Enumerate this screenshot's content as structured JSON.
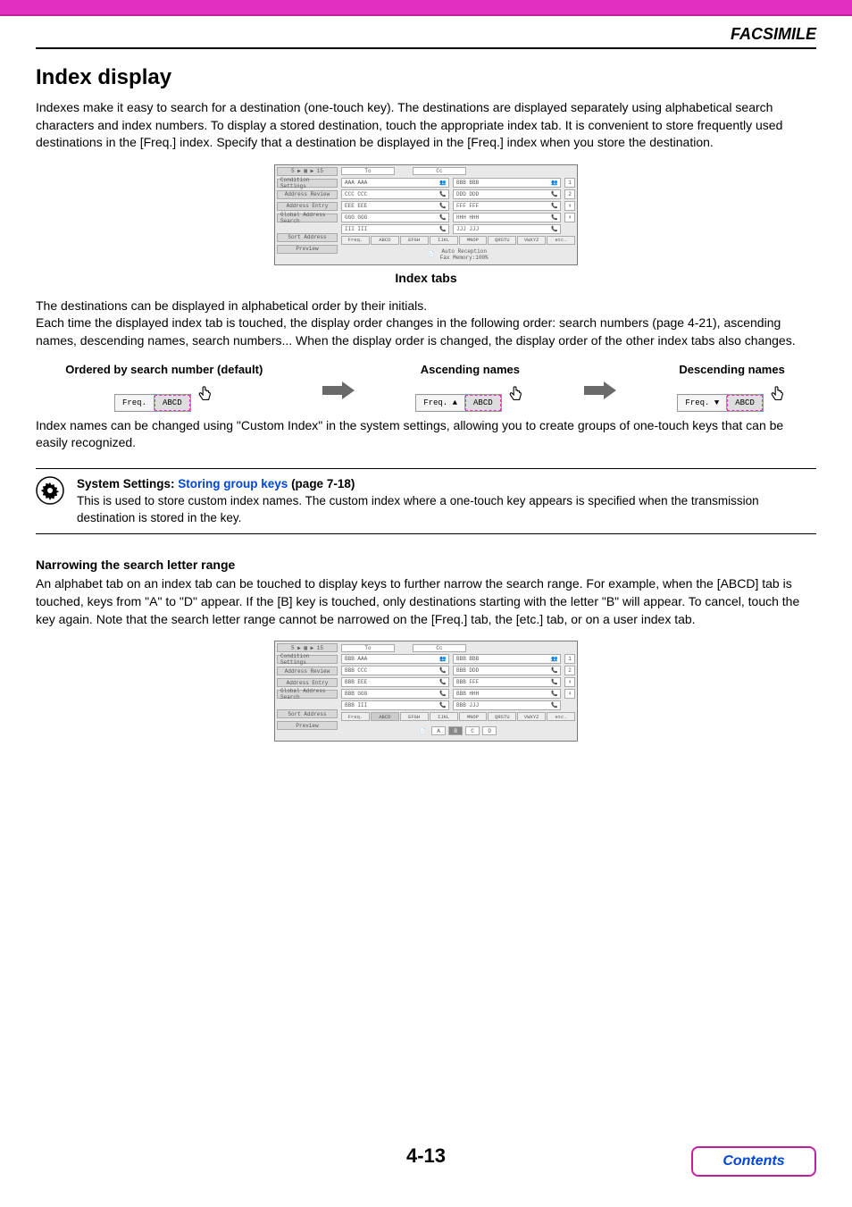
{
  "header": {
    "section": "FACSIMILE"
  },
  "title": "Index display",
  "intro": "Indexes make it easy to search for a destination (one-touch key). The destinations are displayed separately using alphabetical search characters and index numbers. To display a stored destination, touch the appropriate index tab. It is convenient to store frequently used destinations in the [Freq.] index. Specify that a destination be displayed in the [Freq.] index when you store the destination.",
  "screenshot1": {
    "breadcrumbs": "5 ▶ ▦ ▶ 15",
    "tabs": {
      "to": "To",
      "cc": "Cc"
    },
    "left_buttons": [
      "Condition Settings",
      "Address Review",
      "Address Entry",
      "Global Address Search",
      "Sort Address",
      "Preview"
    ],
    "rows": [
      [
        "AAA AAA",
        "BBB BBB"
      ],
      [
        "CCC CCC",
        "DDD DDD"
      ],
      [
        "EEE EEE",
        "FFF FFF"
      ],
      [
        "GGG GGG",
        "HHH HHH"
      ],
      [
        "III III",
        "JJJ JJJ"
      ]
    ],
    "scroll": [
      "1",
      "2",
      "⬆",
      "⬇"
    ],
    "index_tabs": [
      "Freq.",
      "ABCD",
      "EFGH",
      "IJKL",
      "MNOP",
      "QRSTU",
      "VWXYZ",
      "etc."
    ],
    "footer": {
      "line1": "Auto Reception",
      "line2": "Fax Memory:100%"
    }
  },
  "caption1": "Index tabs",
  "para2_l1": "The destinations can be displayed in alphabetical order by their initials.",
  "para2_l2": "Each time the displayed index tab is touched, the display order changes in the following order: search numbers (page 4-21), ascending names, descending names, search numbers... When the display order is changed, the display order of the other index tabs also changes.",
  "sort_labels": {
    "a": "Ordered by search number (default)",
    "b": "Ascending names",
    "c": "Descending names"
  },
  "mini_tabs": {
    "freq": "Freq.",
    "abcd": "ABCD"
  },
  "para3": "Index names can be changed using \"Custom Index\" in the system settings, allowing you to create groups of one-touch keys that can be easily recognized.",
  "callout": {
    "prefix": "System Settings: ",
    "link": "Storing group keys",
    "suffix": " (page 7-18)",
    "body": "This is used to store custom index names. The custom index where a one-touch key appears is specified when the transmission destination is stored in the key."
  },
  "narrow_h": "Narrowing the search letter range",
  "narrow_p": "An alphabet tab on an index tab can be touched to display keys to further narrow the search range. For example, when the [ABCD] tab is touched, keys from \"A\" to \"D\" appear. If the [B] key is touched, only destinations starting with the letter \"B\" will appear. To cancel, touch the key again. Note that the search letter range cannot be narrowed on the [Freq.] tab, the [etc.] tab, or on a user index tab.",
  "screenshot2": {
    "rows": [
      [
        "BBB AAA",
        "BBB BBB"
      ],
      [
        "BBB CCC",
        "BBB DDD"
      ],
      [
        "BBB EEE",
        "BBB FFF"
      ],
      [
        "BBB GGG",
        "BBB HHH"
      ],
      [
        "BBB III",
        "BBB JJJ"
      ]
    ],
    "sub_tabs": [
      "A",
      "B",
      "C",
      "D"
    ]
  },
  "page_number": "4-13",
  "contents_btn": "Contents"
}
